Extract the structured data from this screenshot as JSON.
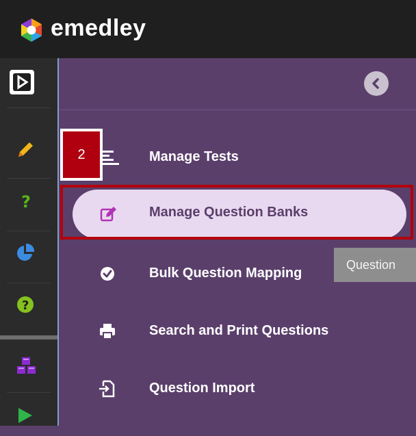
{
  "app": {
    "brand": "emedley",
    "colors": {
      "topbar": "#1f1f1f",
      "panel": "#5b3f6b",
      "active_pill": "#e8d9f0",
      "highlight": "#b3000c"
    }
  },
  "rail": {
    "items": [
      {
        "name": "play-icon",
        "color": "#ffffff"
      },
      {
        "name": "pencil-icon",
        "color": "#f2b51b"
      },
      {
        "name": "question-mark-icon",
        "color": "#58b31b"
      },
      {
        "name": "pie-chart-icon",
        "color": "#3b8be0"
      },
      {
        "name": "help-circle-icon",
        "color": "#86c11f"
      },
      {
        "name": "cubes-icon",
        "color": "#8d2bd1"
      },
      {
        "name": "play-triangle-icon",
        "color": "#2fb44a"
      }
    ]
  },
  "menu": {
    "items": [
      {
        "label": "Manage Tests",
        "icon": "list-lines-icon"
      },
      {
        "label": "Manage Question Banks",
        "icon": "edit-icon",
        "active": true
      },
      {
        "label": "Bulk Question Mapping",
        "icon": "check-circle-icon"
      },
      {
        "label": "Search and Print Questions",
        "icon": "printer-icon"
      },
      {
        "label": "Question Import",
        "icon": "import-file-icon"
      }
    ]
  },
  "annotation": {
    "step": "2"
  },
  "tooltip": {
    "text": "Question"
  }
}
